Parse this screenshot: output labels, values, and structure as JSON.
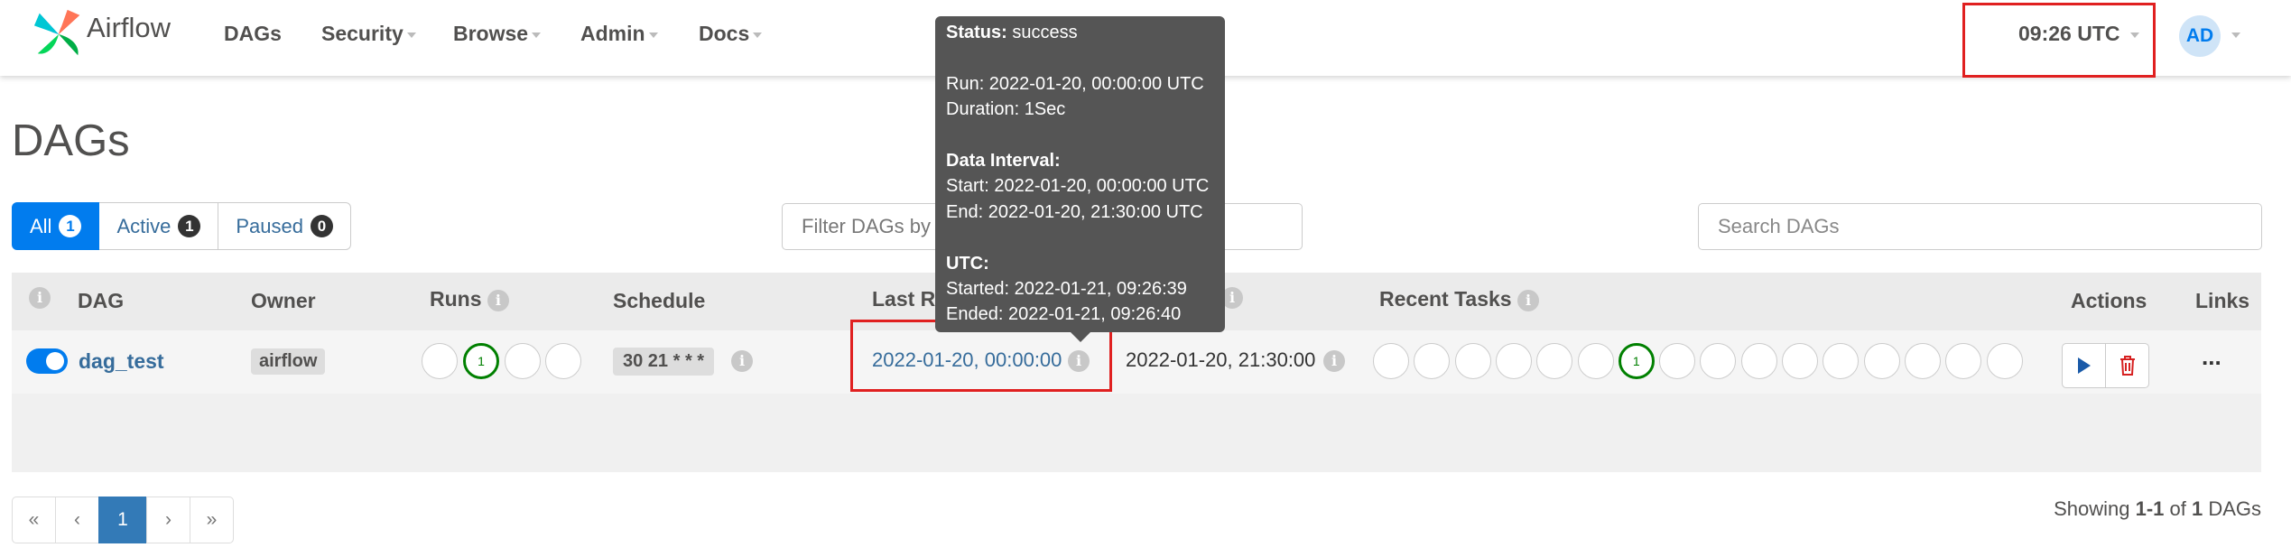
{
  "brand": {
    "name": "Airflow",
    "logo_icon": "airflow-pinwheel-icon"
  },
  "nav": {
    "items": [
      {
        "label": "DAGs",
        "dropdown": false
      },
      {
        "label": "Security",
        "dropdown": true
      },
      {
        "label": "Browse",
        "dropdown": true
      },
      {
        "label": "Admin",
        "dropdown": true
      },
      {
        "label": "Docs",
        "dropdown": true
      }
    ],
    "time": "09:26 UTC",
    "user_initials": "AD"
  },
  "page": {
    "title": "DAGs"
  },
  "filters": {
    "all": {
      "label": "All",
      "count": "1"
    },
    "active": {
      "label": "Active",
      "count": "1"
    },
    "paused": {
      "label": "Paused",
      "count": "0"
    },
    "filter_placeholder": "Filter DAGs by",
    "search_placeholder": "Search DAGs"
  },
  "table": {
    "headers": {
      "dag": "DAG",
      "owner": "Owner",
      "runs": "Runs",
      "schedule": "Schedule",
      "last_run": "Last Ru",
      "recent_tasks": "Recent Tasks",
      "actions": "Actions",
      "links": "Links"
    },
    "rows": [
      {
        "dag_id": "dag_test",
        "owner": "airflow",
        "runs_success_count": "1",
        "schedule": "30 21 * * *",
        "last_run": "2022-01-20, 00:00:00",
        "next_run": "2022-01-20, 21:30:00",
        "recent_task_success_count": "1",
        "links": "..."
      }
    ]
  },
  "pagination": {
    "first": "«",
    "prev": "‹",
    "current": "1",
    "next": "›",
    "last": "»"
  },
  "showing": {
    "prefix": "Showing ",
    "range": "1-1",
    "of": " of ",
    "total": "1",
    "suffix": " DAGs"
  },
  "tooltip": {
    "status_label": "Status:",
    "status_value": " success",
    "run": "Run: 2022-01-20, 00:00:00 UTC",
    "duration": "Duration: 1Sec",
    "data_interval_label": "Data Interval:",
    "start": "Start: 2022-01-20, 00:00:00 UTC",
    "end": "End: 2022-01-20, 21:30:00 UTC",
    "utc_label": "UTC:",
    "started": "Started: 2022-01-21, 09:26:39",
    "ended": "Ended: 2022-01-21, 09:26:40"
  },
  "colors": {
    "accent": "#017cee",
    "success": "#008000",
    "highlight": "#e02020",
    "link": "#366c9b"
  }
}
